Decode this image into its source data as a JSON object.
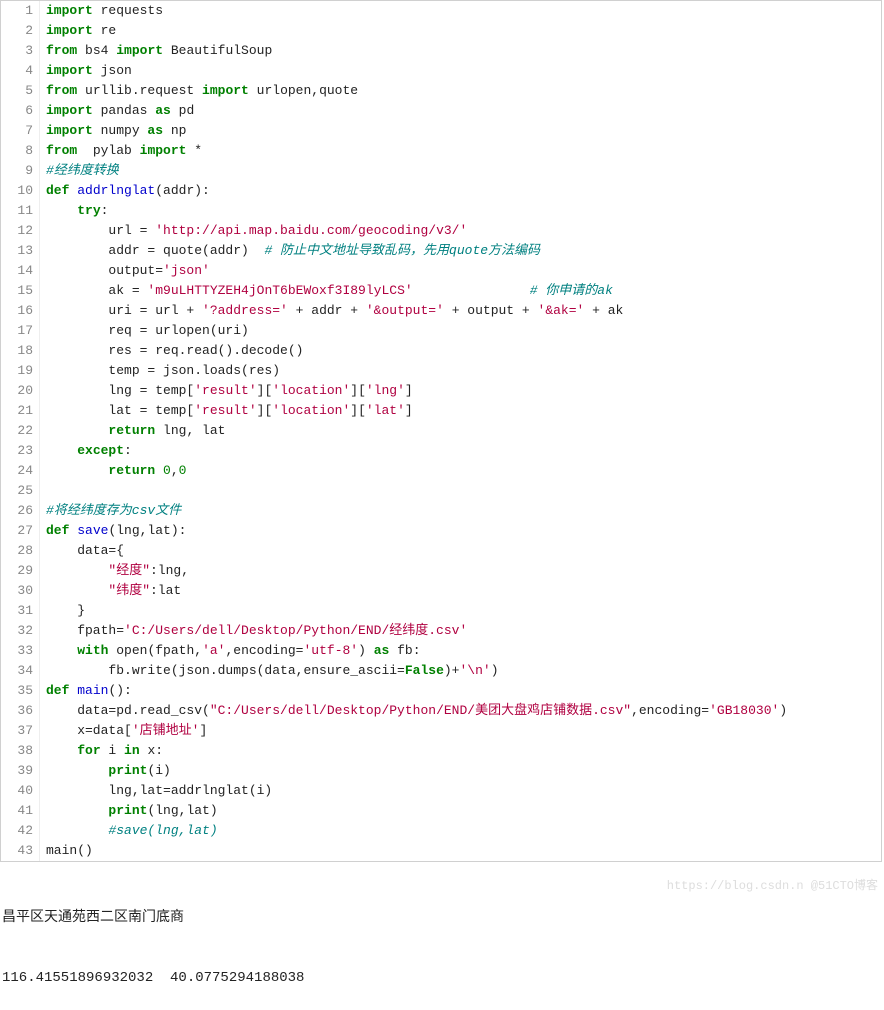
{
  "code": {
    "l1": [
      [
        "kw",
        "import"
      ],
      [
        "plain",
        " requests"
      ]
    ],
    "l2": [
      [
        "kw",
        "import"
      ],
      [
        "plain",
        " re"
      ]
    ],
    "l3": [
      [
        "kw",
        "from"
      ],
      [
        "plain",
        " bs4 "
      ],
      [
        "kw",
        "import"
      ],
      [
        "plain",
        " BeautifulSoup"
      ]
    ],
    "l4": [
      [
        "kw",
        "import"
      ],
      [
        "plain",
        " json"
      ]
    ],
    "l5": [
      [
        "kw",
        "from"
      ],
      [
        "plain",
        " urllib.request "
      ],
      [
        "kw",
        "import"
      ],
      [
        "plain",
        " urlopen,quote"
      ]
    ],
    "l6": [
      [
        "kw",
        "import"
      ],
      [
        "plain",
        " pandas "
      ],
      [
        "kw",
        "as"
      ],
      [
        "plain",
        " pd"
      ]
    ],
    "l7": [
      [
        "kw",
        "import"
      ],
      [
        "plain",
        " numpy "
      ],
      [
        "kw",
        "as"
      ],
      [
        "plain",
        " np"
      ]
    ],
    "l8": [
      [
        "kw",
        "from"
      ],
      [
        "plain",
        "  pylab "
      ],
      [
        "kw",
        "import"
      ],
      [
        "plain",
        " *"
      ]
    ],
    "l9": [
      [
        "cmt",
        "#经纬度转换"
      ]
    ],
    "l10": [
      [
        "kw",
        "def"
      ],
      [
        "plain",
        " "
      ],
      [
        "fn",
        "addrlnglat"
      ],
      [
        "plain",
        "(addr):"
      ]
    ],
    "l11": [
      [
        "plain",
        "    "
      ],
      [
        "kw",
        "try"
      ],
      [
        "plain",
        ":"
      ]
    ],
    "l12": [
      [
        "plain",
        "        url = "
      ],
      [
        "str",
        "'http://api.map.baidu.com/geocoding/v3/'"
      ]
    ],
    "l13": [
      [
        "plain",
        "        addr = quote(addr)  "
      ],
      [
        "cmt",
        "# 防止中文地址导致乱码，先用quote方法编码"
      ]
    ],
    "l14": [
      [
        "plain",
        "        output="
      ],
      [
        "str",
        "'json'"
      ]
    ],
    "l15": [
      [
        "plain",
        "        ak = "
      ],
      [
        "str",
        "'m9uLHTTYZEH4jOnT6bEWoxf3I89lyLCS'"
      ],
      [
        "plain",
        "               "
      ],
      [
        "cmt",
        "# 你申请的ak"
      ]
    ],
    "l16": [
      [
        "plain",
        "        uri = url + "
      ],
      [
        "str",
        "'?address='"
      ],
      [
        "plain",
        " + addr + "
      ],
      [
        "str",
        "'&output='"
      ],
      [
        "plain",
        " + output + "
      ],
      [
        "str",
        "'&ak='"
      ],
      [
        "plain",
        " + ak"
      ]
    ],
    "l17": [
      [
        "plain",
        "        req = urlopen(uri)"
      ]
    ],
    "l18": [
      [
        "plain",
        "        res = req.read().decode()"
      ]
    ],
    "l19": [
      [
        "plain",
        "        temp = json.loads(res)"
      ]
    ],
    "l20": [
      [
        "plain",
        "        lng = temp["
      ],
      [
        "str",
        "'result'"
      ],
      [
        "plain",
        "]["
      ],
      [
        "str",
        "'location'"
      ],
      [
        "plain",
        "]["
      ],
      [
        "str",
        "'lng'"
      ],
      [
        "plain",
        "]"
      ]
    ],
    "l21": [
      [
        "plain",
        "        lat = temp["
      ],
      [
        "str",
        "'result'"
      ],
      [
        "plain",
        "]["
      ],
      [
        "str",
        "'location'"
      ],
      [
        "plain",
        "]["
      ],
      [
        "str",
        "'lat'"
      ],
      [
        "plain",
        "]"
      ]
    ],
    "l22": [
      [
        "plain",
        "        "
      ],
      [
        "kw",
        "return"
      ],
      [
        "plain",
        " lng, lat"
      ]
    ],
    "l23": [
      [
        "plain",
        "    "
      ],
      [
        "kw",
        "except"
      ],
      [
        "plain",
        ":"
      ]
    ],
    "l24": [
      [
        "plain",
        "        "
      ],
      [
        "kw",
        "return"
      ],
      [
        "plain",
        " "
      ],
      [
        "num",
        "0"
      ],
      [
        "plain",
        ","
      ],
      [
        "num",
        "0"
      ]
    ],
    "l25": [
      [
        "plain",
        ""
      ]
    ],
    "l26": [
      [
        "cmt",
        "#将经纬度存为csv文件"
      ]
    ],
    "l27": [
      [
        "kw",
        "def"
      ],
      [
        "plain",
        " "
      ],
      [
        "fn",
        "save"
      ],
      [
        "plain",
        "(lng,lat):"
      ]
    ],
    "l28": [
      [
        "plain",
        "    data={"
      ]
    ],
    "l29": [
      [
        "plain",
        "        "
      ],
      [
        "str",
        "\"经度\""
      ],
      [
        "plain",
        ":lng,"
      ]
    ],
    "l30": [
      [
        "plain",
        "        "
      ],
      [
        "str",
        "\"纬度\""
      ],
      [
        "plain",
        ":lat"
      ]
    ],
    "l31": [
      [
        "plain",
        "    }"
      ]
    ],
    "l32": [
      [
        "plain",
        "    fpath="
      ],
      [
        "str",
        "'C:/Users/dell/Desktop/Python/END/经纬度.csv'"
      ]
    ],
    "l33": [
      [
        "plain",
        "    "
      ],
      [
        "kw",
        "with"
      ],
      [
        "plain",
        " open(fpath,"
      ],
      [
        "str",
        "'a'"
      ],
      [
        "plain",
        ",encoding="
      ],
      [
        "str",
        "'utf-8'"
      ],
      [
        "plain",
        ") "
      ],
      [
        "kw",
        "as"
      ],
      [
        "plain",
        " fb:"
      ]
    ],
    "l34": [
      [
        "plain",
        "        fb.write(json.dumps(data,ensure_ascii="
      ],
      [
        "kw",
        "False"
      ],
      [
        "plain",
        ")+"
      ],
      [
        "str",
        "'\\n'"
      ],
      [
        "plain",
        ")"
      ]
    ],
    "l35": [
      [
        "kw",
        "def"
      ],
      [
        "plain",
        " "
      ],
      [
        "fn",
        "main"
      ],
      [
        "plain",
        "():"
      ]
    ],
    "l36": [
      [
        "plain",
        "    data=pd.read_csv("
      ],
      [
        "str",
        "\"C:/Users/dell/Desktop/Python/END/美团大盘鸡店铺数据.csv\""
      ],
      [
        "plain",
        ",encoding="
      ],
      [
        "str",
        "'GB18030'"
      ],
      [
        "plain",
        ")"
      ]
    ],
    "l37": [
      [
        "plain",
        "    x=data["
      ],
      [
        "str",
        "'店铺地址'"
      ],
      [
        "plain",
        "]"
      ]
    ],
    "l38": [
      [
        "plain",
        "    "
      ],
      [
        "kw",
        "for"
      ],
      [
        "plain",
        " i "
      ],
      [
        "kw",
        "in"
      ],
      [
        "plain",
        " x:"
      ]
    ],
    "l39": [
      [
        "plain",
        "        "
      ],
      [
        "kw",
        "print"
      ],
      [
        "plain",
        "(i)"
      ]
    ],
    "l40": [
      [
        "plain",
        "        lng,lat=addrlnglat(i)"
      ]
    ],
    "l41": [
      [
        "plain",
        "        "
      ],
      [
        "kw",
        "print"
      ],
      [
        "plain",
        "(lng,lat)"
      ]
    ],
    "l42": [
      [
        "plain",
        "        "
      ],
      [
        "cmt",
        "#save(lng,lat)"
      ]
    ],
    "l43": [
      [
        "plain",
        "main()"
      ]
    ]
  },
  "gutter": {
    "g1": "1",
    "g2": "2",
    "g3": "3",
    "g4": "4",
    "g5": "5",
    "g6": "6",
    "g7": "7",
    "g8": "8",
    "g9": "9",
    "g10": "10",
    "g11": "11",
    "g12": "12",
    "g13": "13",
    "g14": "14",
    "g15": "15",
    "g16": "16",
    "g17": "17",
    "g18": "18",
    "g19": "19",
    "g20": "20",
    "g21": "21",
    "g22": "22",
    "g23": "23",
    "g24": "24",
    "g25": "25",
    "g26": "26",
    "g27": "27",
    "g28": "28",
    "g29": "29",
    "g30": "30",
    "g31": "31",
    "g32": "32",
    "g33": "33",
    "g34": "34",
    "g35": "35",
    "g36": "36",
    "g37": "37",
    "g38": "38",
    "g39": "39",
    "g40": "40",
    "g41": "41",
    "g42": "42",
    "g43": "43"
  },
  "console": {
    "line1": "昌平区天通苑西二区南门底商",
    "line2": "116.41551896932032  40.0775294188038"
  },
  "watermark": "https://blog.csdn.n   @51CTO博客"
}
